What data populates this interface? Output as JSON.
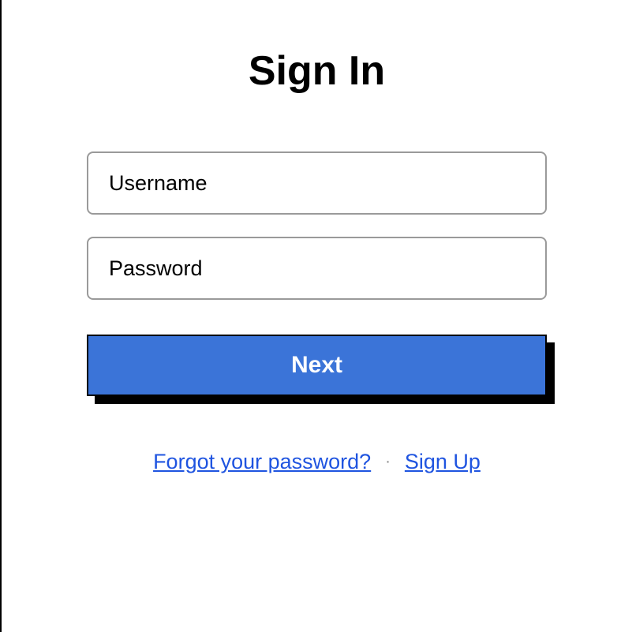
{
  "form": {
    "title": "Sign In",
    "username_placeholder": "Username",
    "password_placeholder": "Password",
    "next_label": "Next"
  },
  "links": {
    "forgot_password": "Forgot your password?",
    "separator": "·",
    "sign_up": "Sign Up"
  }
}
